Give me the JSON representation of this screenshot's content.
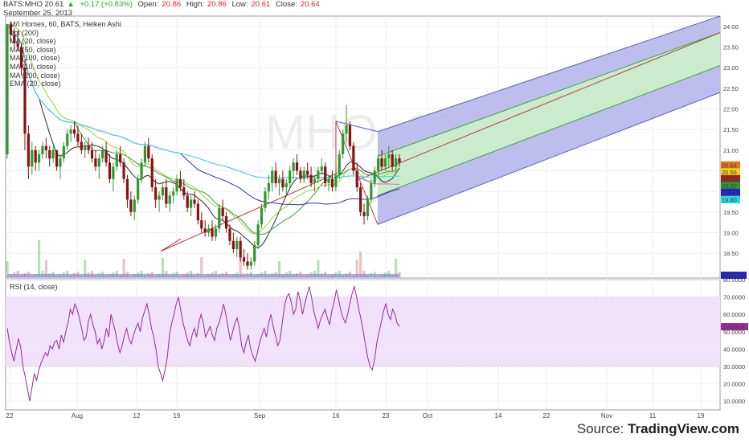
{
  "header": {
    "symbol_price": "BATS:MHO 20.61",
    "change": "+0.17 (+0.83%)",
    "open_label": "Open:",
    "open": "20.86",
    "high_label": "High:",
    "high": "20.86",
    "low_label": "Low:",
    "low": "20.61",
    "close_label": "Close:",
    "close": "20.64",
    "date": "September 25, 2013"
  },
  "legend": {
    "title": "M/I Homes, 60, BATS, Heiken Ashi",
    "items": [
      "Vol (200)",
      "MA (20, close)",
      "MA (50, close)",
      "MA (100, close)",
      "MA (10, close)",
      "MA (200, close)",
      "EMA (20, close)"
    ]
  },
  "watermark": {
    "symbol": "MHO, 60",
    "name": "M/I Homes"
  },
  "rsi_legend": "RSI (14, close)",
  "source": {
    "prefix": "Source: ",
    "brand": "TradingView.com"
  },
  "colors": {
    "candle_up": "#2e9a2e",
    "candle_down": "#8b1010",
    "channel_outer_fill": "#b7b7ec",
    "channel_inner_fill": "#ccefc9",
    "channel_edge": "#5a5ad0",
    "rsi_band": "#f0e2fb",
    "rsi_line": "#9a2a9a"
  },
  "chart_data": {
    "type": "candlestick",
    "subtype": "Heiken Ashi, 60 min",
    "x_tick_labels": [
      "22",
      "Aug",
      "12",
      "19",
      "Sep",
      "16",
      "23",
      "Oct",
      "14",
      "22",
      "Nov",
      "11",
      "19"
    ],
    "price_axis": {
      "ylim": [
        17.9,
        24.25
      ],
      "ticks": [
        "24.00",
        "23.50",
        "23.00",
        "22.50",
        "22.00",
        "21.50",
        "21.00",
        "20.50",
        "20.00",
        "19.50",
        "19.00",
        "18.50",
        "18.00"
      ]
    },
    "price_tags": [
      {
        "label": "20.64",
        "value": 20.64,
        "color": "#e6731d"
      },
      {
        "label": "20.56",
        "value": 20.56,
        "color": "#f0d20a"
      },
      {
        "label": "20.46",
        "value": 20.46,
        "color": "#a02020"
      },
      {
        "label": "20.37",
        "value": 20.37,
        "color": "#2a9a2a"
      },
      {
        "label": "20.20",
        "value": 20.2,
        "color": "#2222c8"
      },
      {
        "label": "19.80",
        "value": 19.8,
        "color": "#22dddd"
      }
    ],
    "volume_tag": {
      "label": "2.684K",
      "color": "#2222c8"
    },
    "rsi": {
      "ylim": [
        5,
        80
      ],
      "ticks": [
        "80.0000",
        "70.0000",
        "60.0000",
        "50.0000",
        "40.0000",
        "30.0000",
        "20.0000",
        "10.0000"
      ],
      "band": [
        30,
        70
      ],
      "last": "52.8919",
      "values": [
        52,
        44,
        38,
        33,
        40,
        46,
        41,
        30,
        24,
        17,
        10,
        18,
        26,
        22,
        28,
        32,
        35,
        38,
        36,
        42,
        40,
        44,
        45,
        40,
        48,
        44,
        50,
        55,
        63,
        60,
        66,
        63,
        58,
        52,
        45,
        47,
        56,
        60,
        54,
        50,
        43,
        46,
        40,
        45,
        52,
        47,
        60,
        55,
        50,
        43,
        38,
        42,
        48,
        52,
        46,
        43,
        48,
        52,
        55,
        50,
        58,
        62,
        66,
        60,
        52,
        47,
        40,
        30,
        26,
        22,
        28,
        35,
        48,
        55,
        60,
        66,
        70,
        62,
        55,
        50,
        45,
        42,
        48,
        52,
        47,
        55,
        60,
        55,
        47,
        50,
        53,
        48,
        45,
        52,
        55,
        60,
        66,
        60,
        52,
        45,
        50,
        55,
        58,
        52,
        42,
        38,
        44,
        48,
        40,
        36,
        33,
        38,
        44,
        48,
        52,
        47,
        55,
        60,
        53,
        48,
        42,
        45,
        55,
        65,
        70,
        72,
        67,
        60,
        63,
        73,
        68,
        60,
        66,
        71,
        76,
        70,
        62,
        57,
        52,
        57,
        60,
        63,
        58,
        54,
        62,
        67,
        74,
        69,
        62,
        58,
        55,
        60,
        66,
        72,
        76,
        70,
        63,
        57,
        50,
        42,
        35,
        30,
        28,
        34,
        44,
        50,
        56,
        62,
        66,
        60,
        57,
        63,
        60,
        55,
        53
      ]
    },
    "candles": [
      [
        20.9,
        24.05,
        20.8,
        24.05
      ],
      [
        24.05,
        24.1,
        23.6,
        23.8
      ],
      [
        23.8,
        23.95,
        23.5,
        23.6
      ],
      [
        23.6,
        23.9,
        23.4,
        23.5
      ],
      [
        23.5,
        23.6,
        22.8,
        23.0
      ],
      [
        23.0,
        23.2,
        21.0,
        21.4
      ],
      [
        21.4,
        21.6,
        20.3,
        20.6
      ],
      [
        20.6,
        21.2,
        20.4,
        21.0
      ],
      [
        21.0,
        21.1,
        20.5,
        20.7
      ],
      [
        20.7,
        21.0,
        20.5,
        20.9
      ],
      [
        20.9,
        21.2,
        20.8,
        21.1
      ],
      [
        21.1,
        21.3,
        20.8,
        21.0
      ],
      [
        21.0,
        21.1,
        20.6,
        20.8
      ],
      [
        20.8,
        21.1,
        20.7,
        21.0
      ],
      [
        21.0,
        21.0,
        20.5,
        20.6
      ],
      [
        20.6,
        20.9,
        20.3,
        20.8
      ],
      [
        20.8,
        21.2,
        20.7,
        21.1
      ],
      [
        21.1,
        21.5,
        21.0,
        21.4
      ],
      [
        21.4,
        21.6,
        21.2,
        21.5
      ],
      [
        21.5,
        21.7,
        21.3,
        21.4
      ],
      [
        21.4,
        21.6,
        21.1,
        21.2
      ],
      [
        21.2,
        21.4,
        20.9,
        21.0
      ],
      [
        21.0,
        21.2,
        20.8,
        21.1
      ],
      [
        21.1,
        21.3,
        20.9,
        21.0
      ],
      [
        21.0,
        21.2,
        20.7,
        20.8
      ],
      [
        20.8,
        21.0,
        20.5,
        20.6
      ],
      [
        20.6,
        20.9,
        20.3,
        20.8
      ],
      [
        20.8,
        21.1,
        20.7,
        21.0
      ],
      [
        21.0,
        21.2,
        20.6,
        20.7
      ],
      [
        20.7,
        20.9,
        20.2,
        20.3
      ],
      [
        20.3,
        20.7,
        20.0,
        20.6
      ],
      [
        20.6,
        21.0,
        20.5,
        20.9
      ],
      [
        20.9,
        21.1,
        20.6,
        20.7
      ],
      [
        20.7,
        20.8,
        20.2,
        20.3
      ],
      [
        20.3,
        20.4,
        19.6,
        19.8
      ],
      [
        19.8,
        20.0,
        19.4,
        19.5
      ],
      [
        19.5,
        19.9,
        19.3,
        19.8
      ],
      [
        19.8,
        20.4,
        19.7,
        20.3
      ],
      [
        20.3,
        20.8,
        20.2,
        20.7
      ],
      [
        20.7,
        21.2,
        20.6,
        21.1
      ],
      [
        21.1,
        21.3,
        20.7,
        20.8
      ],
      [
        20.8,
        20.9,
        20.0,
        20.1
      ],
      [
        20.1,
        20.3,
        19.6,
        19.8
      ],
      [
        19.8,
        20.0,
        19.5,
        19.9
      ],
      [
        19.9,
        20.2,
        19.8,
        20.1
      ],
      [
        20.1,
        20.3,
        19.6,
        19.7
      ],
      [
        19.7,
        20.0,
        19.5,
        19.9
      ],
      [
        19.9,
        20.1,
        19.7,
        20.0
      ],
      [
        20.0,
        20.4,
        19.9,
        20.3
      ],
      [
        20.3,
        20.5,
        20.0,
        20.1
      ],
      [
        20.1,
        20.3,
        19.8,
        19.9
      ],
      [
        19.9,
        20.0,
        19.5,
        19.6
      ],
      [
        19.6,
        19.9,
        19.4,
        19.8
      ],
      [
        19.8,
        20.0,
        19.6,
        19.7
      ],
      [
        19.7,
        19.8,
        19.2,
        19.3
      ],
      [
        19.3,
        19.5,
        19.0,
        19.1
      ],
      [
        19.1,
        19.3,
        18.9,
        19.0
      ],
      [
        19.0,
        19.2,
        18.9,
        19.1
      ],
      [
        19.1,
        19.3,
        18.8,
        18.9
      ],
      [
        18.9,
        19.2,
        18.8,
        19.1
      ],
      [
        19.1,
        19.7,
        19.0,
        19.6
      ],
      [
        19.6,
        19.8,
        19.3,
        19.4
      ],
      [
        19.4,
        19.5,
        19.0,
        19.1
      ],
      [
        19.1,
        19.2,
        18.7,
        18.8
      ],
      [
        18.8,
        19.0,
        18.5,
        18.6
      ],
      [
        18.6,
        18.9,
        18.4,
        18.8
      ],
      [
        18.8,
        18.9,
        18.3,
        18.4
      ],
      [
        18.4,
        18.6,
        18.2,
        18.3
      ],
      [
        18.3,
        18.5,
        18.1,
        18.2
      ],
      [
        18.2,
        18.4,
        18.1,
        18.3
      ],
      [
        18.3,
        18.8,
        18.2,
        18.7
      ],
      [
        18.7,
        19.3,
        18.6,
        19.2
      ],
      [
        19.2,
        19.7,
        19.1,
        19.6
      ],
      [
        19.6,
        20.1,
        19.5,
        20.0
      ],
      [
        20.0,
        20.4,
        19.8,
        20.2
      ],
      [
        20.2,
        20.6,
        20.0,
        20.5
      ],
      [
        20.5,
        20.7,
        20.1,
        20.2
      ],
      [
        20.2,
        20.4,
        19.9,
        20.3
      ],
      [
        20.3,
        20.5,
        20.0,
        20.1
      ],
      [
        20.1,
        20.3,
        19.9,
        20.2
      ],
      [
        20.2,
        20.6,
        20.1,
        20.5
      ],
      [
        20.5,
        20.8,
        20.3,
        20.7
      ],
      [
        20.7,
        20.9,
        20.4,
        20.5
      ],
      [
        20.5,
        20.6,
        20.2,
        20.3
      ],
      [
        20.3,
        20.6,
        20.2,
        20.5
      ],
      [
        20.5,
        20.7,
        20.3,
        20.4
      ],
      [
        20.4,
        20.6,
        20.1,
        20.2
      ],
      [
        20.2,
        20.4,
        20.0,
        20.3
      ],
      [
        20.3,
        20.6,
        20.2,
        20.5
      ],
      [
        20.5,
        20.8,
        20.4,
        20.6
      ],
      [
        20.6,
        20.7,
        20.1,
        20.2
      ],
      [
        20.2,
        20.4,
        20.0,
        20.3
      ],
      [
        20.3,
        20.5,
        20.0,
        20.1
      ],
      [
        20.1,
        20.5,
        20.0,
        20.4
      ],
      [
        20.4,
        21.0,
        20.3,
        20.9
      ],
      [
        20.9,
        21.5,
        20.8,
        21.4
      ],
      [
        21.4,
        22.1,
        21.2,
        21.6
      ],
      [
        21.6,
        21.7,
        21.0,
        21.1
      ],
      [
        21.1,
        21.2,
        20.4,
        20.5
      ],
      [
        20.5,
        20.7,
        20.0,
        20.1
      ],
      [
        20.1,
        20.2,
        19.4,
        19.5
      ],
      [
        19.5,
        19.7,
        19.2,
        19.4
      ],
      [
        19.4,
        19.9,
        19.3,
        19.8
      ],
      [
        19.8,
        20.3,
        19.7,
        20.2
      ],
      [
        20.2,
        20.6,
        20.1,
        20.5
      ],
      [
        20.5,
        20.9,
        20.3,
        20.8
      ],
      [
        20.8,
        21.0,
        20.5,
        20.6
      ],
      [
        20.6,
        20.9,
        20.5,
        20.8
      ],
      [
        20.8,
        21.1,
        20.6,
        20.9
      ],
      [
        20.9,
        21.0,
        20.5,
        20.6
      ],
      [
        20.6,
        20.9,
        20.5,
        20.8
      ],
      [
        20.8,
        20.9,
        20.6,
        20.7
      ]
    ]
  }
}
